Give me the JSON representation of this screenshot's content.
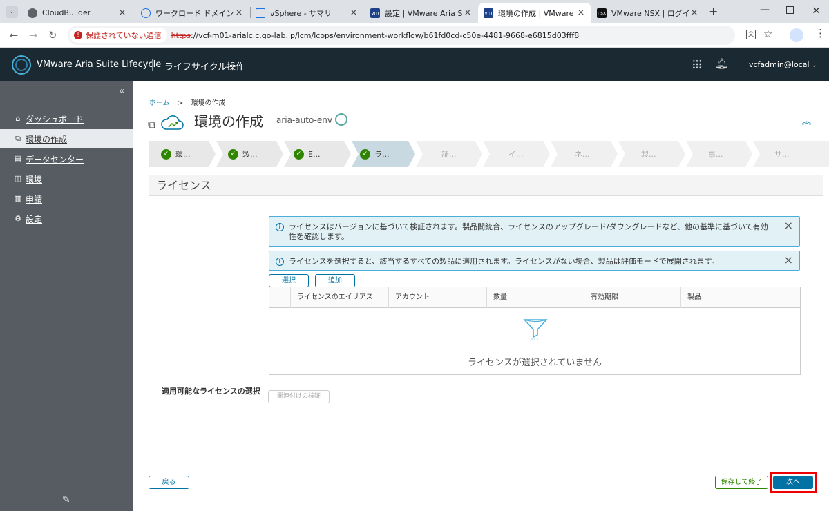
{
  "browser": {
    "tabs": [
      {
        "title": "CloudBuilder",
        "icon": "globe-icon"
      },
      {
        "title": "ワークロード ドメイン - サービス",
        "icon": "cloud-icon"
      },
      {
        "title": "vSphere - サマリ",
        "icon": "vsphere-icon"
      },
      {
        "title": "設定 | VMware Aria Suite",
        "icon": "vmw-icon"
      },
      {
        "title": "環境の作成 | VMware Aria",
        "icon": "vmw-icon",
        "active": true
      },
      {
        "title": "VMware NSX | ログイン",
        "icon": "nsx-icon"
      }
    ],
    "new_tab": "+",
    "security_label": "保護されていない通信",
    "url_scheme": "https",
    "url_rest": "://vcf-m01-arialc.c.go-lab.jp/lcm/lcops/environment-workflow/b61fd0cd-c50e-4481-9668-e6815d03fff8"
  },
  "header": {
    "brand": "VMware Aria Suite Lifecycle",
    "section": "ライフサイクル操作",
    "user": "vcfadmin@local"
  },
  "sidebar": {
    "collapse": "«",
    "items": [
      {
        "label": "ダッシュボード",
        "icon": "home-icon"
      },
      {
        "label": "環境の作成",
        "icon": "copy-icon",
        "active": true
      },
      {
        "label": "データセンター",
        "icon": "datacenter-icon"
      },
      {
        "label": "環境",
        "icon": "environment-icon"
      },
      {
        "label": "申請",
        "icon": "requests-icon"
      },
      {
        "label": "設定",
        "icon": "gear-icon"
      }
    ]
  },
  "breadcrumb": {
    "home": "ホーム",
    "sep": ">",
    "current": "環境の作成"
  },
  "page": {
    "title": "環境の作成",
    "env_name": "aria-auto-env"
  },
  "steps": [
    {
      "label": "環...",
      "done": true
    },
    {
      "label": "製...",
      "done": true
    },
    {
      "label": "E...",
      "done": true
    },
    {
      "label": "ラ...",
      "done": true,
      "current": true
    },
    {
      "label": "証...",
      "done": false
    },
    {
      "label": "イ...",
      "done": false
    },
    {
      "label": "ネ...",
      "done": false
    },
    {
      "label": "製...",
      "done": false
    },
    {
      "label": "事...",
      "done": false
    },
    {
      "label": "サ...",
      "done": false
    }
  ],
  "license": {
    "heading": "ライセンス",
    "alert1": "ライセンスはバージョンに基づいて検証されます。製品間統合、ライセンスのアップグレード/ダウングレードなど、他の基準に基づいて有効性を確認します。",
    "alert2": "ライセンスを選択すると、該当するすべての製品に適用されます。ライセンスがない場合、製品は評価モードで展開されます。",
    "select_btn": "選択",
    "add_btn": "追加",
    "field_label": "適用可能なライセンスの選択",
    "columns": [
      "ライセンスのエイリアス",
      "アカウント",
      "数量",
      "有効期限",
      "製品"
    ],
    "empty": "ライセンスが選択されていません",
    "validate_btn": "関連付けの検証"
  },
  "footer": {
    "back": "戻る",
    "save_exit": "保存して終了",
    "next": "次へ"
  }
}
